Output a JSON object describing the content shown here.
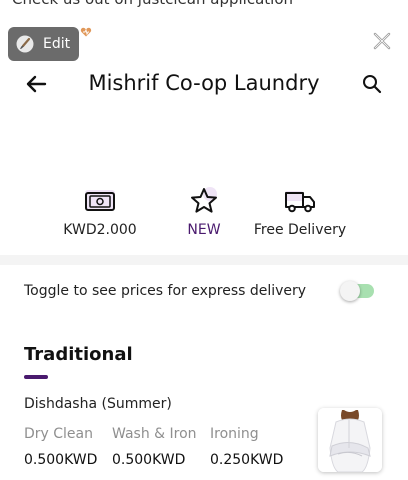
{
  "promo_top_text": "Check us out on justclean application",
  "edit_label": "Edit",
  "header": {
    "title": "Mishrif Co-op Laundry"
  },
  "info": [
    {
      "label": "KWD2.000",
      "icon": "cash-icon"
    },
    {
      "label": "NEW",
      "icon": "star-icon"
    },
    {
      "label": "Free Delivery",
      "icon": "delivery-truck-icon"
    }
  ],
  "express": {
    "text": "Toggle to see prices for express delivery",
    "enabled": false
  },
  "section": {
    "title": "Traditional",
    "items": [
      {
        "name": "Dishdasha (Summer)",
        "services": [
          {
            "label": "Dry Clean",
            "price": "0.500KWD"
          },
          {
            "label": "Wash & Iron",
            "price": "0.500KWD"
          },
          {
            "label": "Ironing",
            "price": "0.250KWD"
          }
        ]
      }
    ]
  },
  "colors": {
    "accent": "#4a1a6e",
    "toggle_track": "#a8e0b0",
    "muted_text": "#8f8f8f"
  }
}
